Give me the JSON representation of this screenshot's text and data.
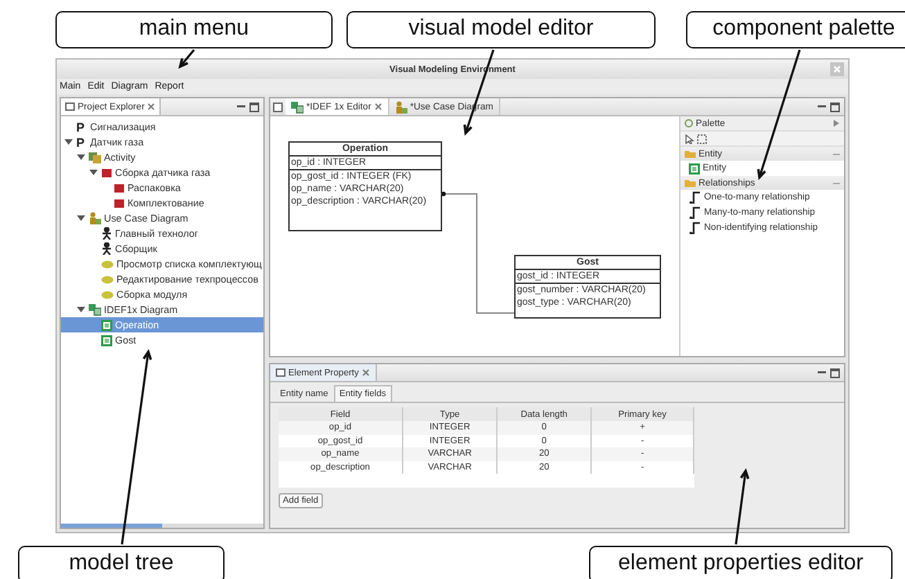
{
  "callouts_top": [
    "main menu",
    "visual model editor",
    "component palette"
  ],
  "window": {
    "title": "Visual Modeling Environment"
  },
  "menu": [
    "Main",
    "Edit",
    "Diagram",
    "Report"
  ],
  "project_explorer": {
    "title": "Project Explorer",
    "items": [
      {
        "label": "Сигнализация",
        "kind": "project",
        "icon": "P",
        "selected": false
      },
      {
        "label": "Датчик газа",
        "kind": "project",
        "icon": "P",
        "selected": false,
        "expanded": true,
        "children": [
          {
            "label": "Activity",
            "kind": "activity-diagram",
            "selected": false,
            "expanded": true,
            "children": [
              {
                "label": "Сборка датчика газа",
                "kind": "activity",
                "selected": false,
                "expanded": true,
                "children": [
                  {
                    "label": "Распаковка",
                    "kind": "activity",
                    "selected": false
                  },
                  {
                    "label": "Комплектование",
                    "kind": "activity",
                    "selected": false
                  }
                ]
              }
            ]
          },
          {
            "label": "Use Case Diagram",
            "kind": "usecase-diagram",
            "selected": false,
            "expanded": true,
            "children": [
              {
                "label": "Главный технолог",
                "kind": "actor",
                "selected": false
              },
              {
                "label": "Сборщик",
                "kind": "actor",
                "selected": false
              },
              {
                "label": "Просмотр списка комплектующ",
                "kind": "usecase",
                "selected": false
              },
              {
                "label": "Редактирование техпроцессов",
                "kind": "usecase",
                "selected": false
              },
              {
                "label": "Сборка модуля",
                "kind": "usecase",
                "selected": false
              }
            ]
          },
          {
            "label": "IDEF1x Diagram",
            "kind": "idef-diagram",
            "selected": false,
            "expanded": true,
            "children": [
              {
                "label": "Operation",
                "kind": "entity",
                "selected": true
              },
              {
                "label": "Gost",
                "kind": "entity",
                "selected": false
              }
            ]
          }
        ]
      }
    ]
  },
  "editor_tabs": [
    {
      "label": "*IDEF 1x Editor",
      "kind": "idef",
      "selected": true
    },
    {
      "label": "*Use Case Diagram",
      "kind": "usecase",
      "selected": false
    }
  ],
  "entities": [
    {
      "name": "Operation",
      "key_attributes": [
        "op_id : INTEGER"
      ],
      "attributes": [
        "op_gost_id : INTEGER (FK)",
        "op_name : VARCHAR(20)",
        "op_description : VARCHAR(20)"
      ]
    },
    {
      "name": "Gost",
      "key_attributes": [
        "gost_id : INTEGER"
      ],
      "attributes": [
        "gost_number : VARCHAR(20)",
        "gost_type : VARCHAR(20)"
      ]
    }
  ],
  "palette": {
    "title": "Palette",
    "drawers": [
      {
        "label": "Entity",
        "expanded": true,
        "items": [
          {
            "label": "Entity",
            "kind": "entity"
          }
        ]
      },
      {
        "label": "Relationships",
        "expanded": true,
        "items": [
          {
            "label": "One-to-many relationship",
            "kind": "relationship"
          },
          {
            "label": "Many-to-many relationship",
            "kind": "relationship"
          },
          {
            "label": "Non-identifying relationship",
            "kind": "relationship"
          }
        ]
      }
    ]
  },
  "element_property": {
    "title": "Element Property",
    "tabs": [
      {
        "label": "Entity name",
        "selected": false
      },
      {
        "label": "Entity fields",
        "selected": true
      }
    ],
    "table": {
      "columns": [
        "Field",
        "Type",
        "Data length",
        "Primary key"
      ],
      "rows": [
        [
          "op_id",
          "INTEGER",
          "0",
          "+"
        ],
        [
          "op_gost_id",
          "INTEGER",
          "0",
          "-"
        ],
        [
          "op_name",
          "VARCHAR",
          "20",
          "-"
        ],
        [
          "op_description",
          "VARCHAR",
          "20",
          "-"
        ]
      ]
    },
    "button": "Add field"
  },
  "callouts_bottom": [
    "model tree",
    "element properties editor"
  ]
}
